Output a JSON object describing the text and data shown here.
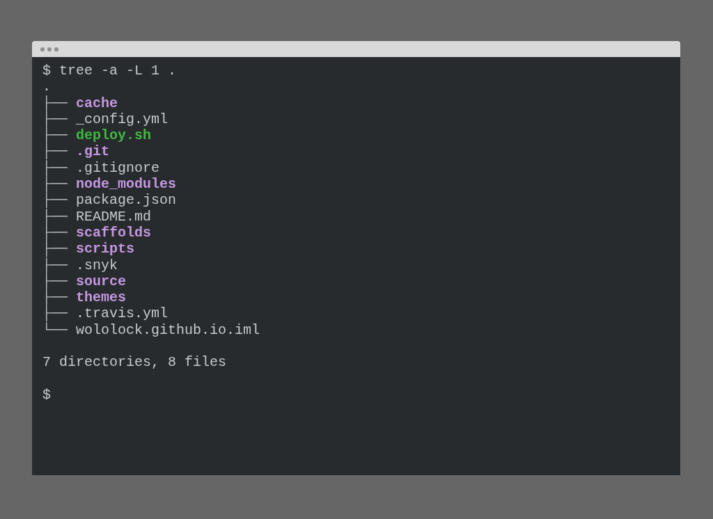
{
  "terminal": {
    "command": "$ tree -a -L 1 .",
    "root": ".",
    "entries": [
      {
        "branch": "├──",
        "name": "cache",
        "kind": "directory"
      },
      {
        "branch": "├──",
        "name": "_config.yml",
        "kind": "file"
      },
      {
        "branch": "├──",
        "name": "deploy.sh",
        "kind": "executable"
      },
      {
        "branch": "├──",
        "name": ".git",
        "kind": "directory"
      },
      {
        "branch": "├──",
        "name": ".gitignore",
        "kind": "file"
      },
      {
        "branch": "├──",
        "name": "node_modules",
        "kind": "directory"
      },
      {
        "branch": "├──",
        "name": "package.json",
        "kind": "file"
      },
      {
        "branch": "├──",
        "name": "README.md",
        "kind": "file"
      },
      {
        "branch": "├──",
        "name": "scaffolds",
        "kind": "directory"
      },
      {
        "branch": "├──",
        "name": "scripts",
        "kind": "directory"
      },
      {
        "branch": "├──",
        "name": ".snyk",
        "kind": "file"
      },
      {
        "branch": "├──",
        "name": "source",
        "kind": "directory"
      },
      {
        "branch": "├──",
        "name": "themes",
        "kind": "directory"
      },
      {
        "branch": "├──",
        "name": ".travis.yml",
        "kind": "file"
      },
      {
        "branch": "└──",
        "name": "wololock.github.io.iml",
        "kind": "file"
      }
    ],
    "summary": "7 directories, 8 files",
    "prompt": "$"
  }
}
